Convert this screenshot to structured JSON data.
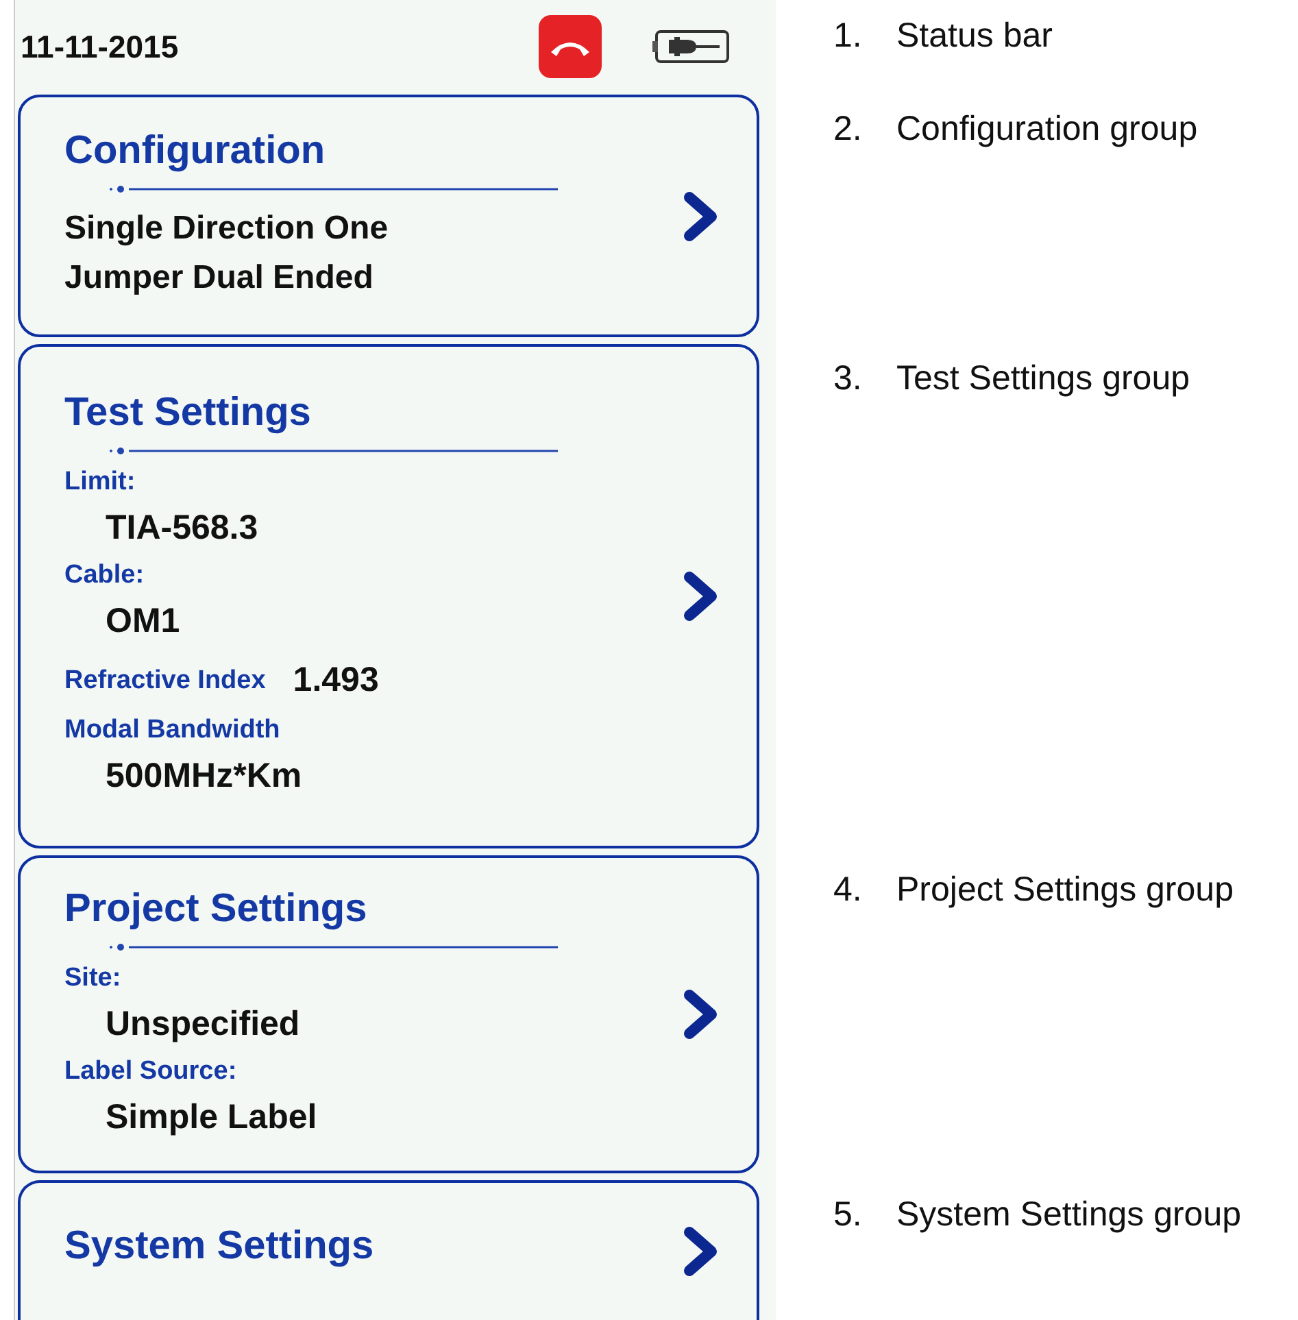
{
  "status_bar": {
    "date": "11-11-2015",
    "annotation": {
      "number": "1.",
      "text": "Status bar"
    }
  },
  "groups": [
    {
      "title": "Configuration",
      "description": [
        "Single Direction One",
        "Jumper Dual Ended"
      ],
      "annotation": {
        "number": "2.",
        "text": "Configuration group"
      }
    },
    {
      "title": "Test Settings",
      "fields": [
        {
          "kind": "stacked",
          "label": "Limit:",
          "value": "TIA-568.3"
        },
        {
          "kind": "stacked",
          "label": "Cable:",
          "value": "OM1"
        },
        {
          "kind": "inline",
          "label": "Refractive Index",
          "value": "1.493"
        },
        {
          "kind": "stacked",
          "label": "Modal Bandwidth",
          "value": "500MHz*Km"
        }
      ],
      "annotation": {
        "number": "3.",
        "text": "Test Settings group"
      }
    },
    {
      "title": "Project Settings",
      "fields": [
        {
          "kind": "stacked",
          "label": "Site:",
          "value": "Unspecified"
        },
        {
          "kind": "stacked",
          "label": "Label Source:",
          "value": "Simple Label"
        }
      ],
      "annotation": {
        "number": "4.",
        "text": "Project Settings group"
      }
    },
    {
      "title": "System Settings",
      "annotation": {
        "number": "5.",
        "text": "System Settings group"
      }
    }
  ]
}
